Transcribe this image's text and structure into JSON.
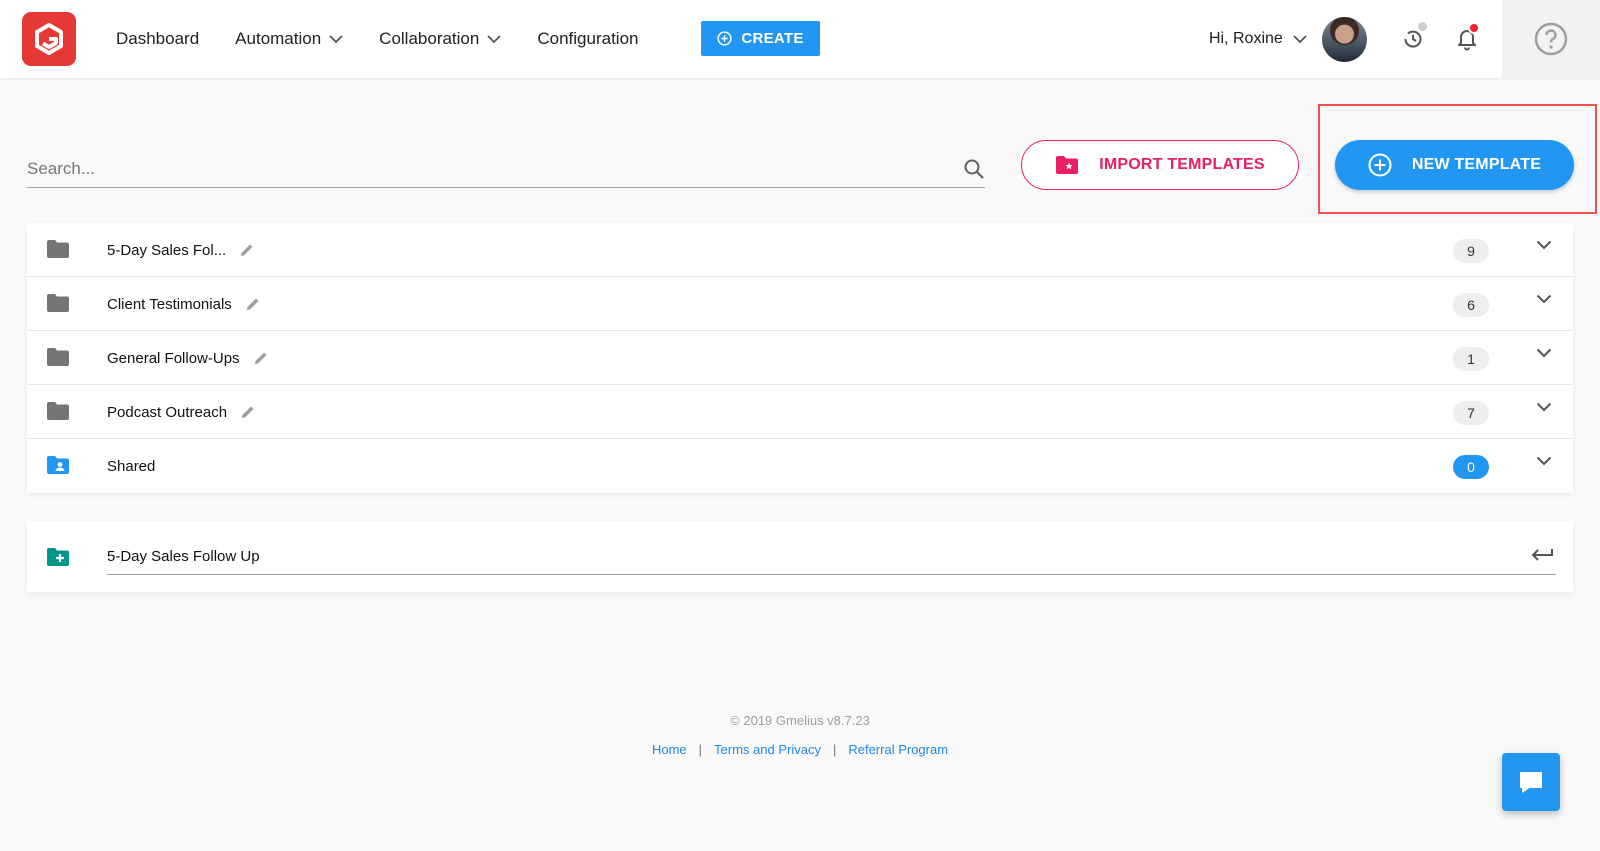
{
  "header": {
    "nav": [
      {
        "label": "Dashboard",
        "has_dropdown": false
      },
      {
        "label": "Automation",
        "has_dropdown": true
      },
      {
        "label": "Collaboration",
        "has_dropdown": true
      },
      {
        "label": "Configuration",
        "has_dropdown": false
      }
    ],
    "create_label": "CREATE",
    "greeting": "Hi, Roxine",
    "icons": [
      "gmelius-logo-icon",
      "history-icon",
      "bell-icon",
      "help-icon"
    ]
  },
  "toolbar": {
    "search_placeholder": "Search...",
    "import_label": "IMPORT TEMPLATES",
    "new_label": "NEW TEMPLATE"
  },
  "folders": [
    {
      "name": "5-Day Sales Fol...",
      "count": "9",
      "editable": true,
      "shared": false
    },
    {
      "name": "Client Testimonials",
      "count": "6",
      "editable": true,
      "shared": false
    },
    {
      "name": "General Follow-Ups",
      "count": "1",
      "editable": true,
      "shared": false
    },
    {
      "name": "Podcast Outreach",
      "count": "7",
      "editable": true,
      "shared": false
    },
    {
      "name": "Shared",
      "count": "0",
      "editable": false,
      "shared": true
    }
  ],
  "new_folder": {
    "value": "5-Day Sales Follow Up"
  },
  "footer": {
    "copyright": "© 2019 Gmelius v8.7.23",
    "links": [
      "Home",
      "Terms and Privacy",
      "Referral Program"
    ]
  },
  "colors": {
    "accent_blue": "#2196f3",
    "import_pink": "#e91e63",
    "logo_red": "#e53935",
    "highlight_red": "#ef5350",
    "new_folder_green": "#009688"
  }
}
